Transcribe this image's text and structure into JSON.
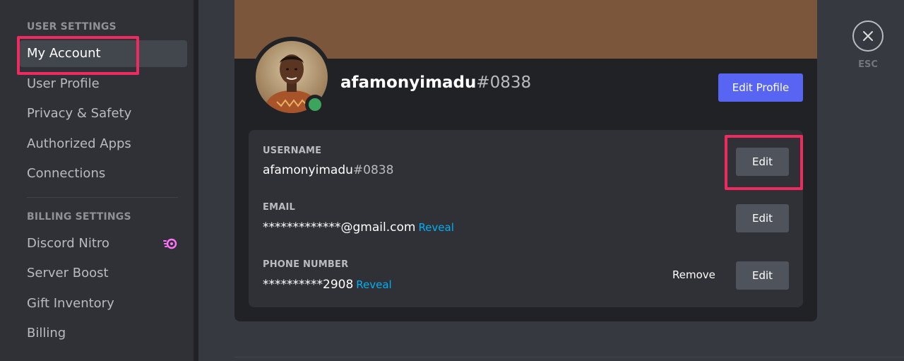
{
  "sidebar": {
    "user_settings_header": "USER SETTINGS",
    "user_items": [
      {
        "label": "My Account",
        "selected": true
      },
      {
        "label": "User Profile"
      },
      {
        "label": "Privacy & Safety"
      },
      {
        "label": "Authorized Apps"
      },
      {
        "label": "Connections"
      }
    ],
    "billing_settings_header": "BILLING SETTINGS",
    "billing_items": [
      {
        "label": "Discord Nitro",
        "icon": "nitro-icon"
      },
      {
        "label": "Server Boost"
      },
      {
        "label": "Gift Inventory"
      },
      {
        "label": "Billing"
      }
    ]
  },
  "profile": {
    "username": "afamonyimadu",
    "discriminator": "#0838",
    "status": "online",
    "banner_color": "#7b563a",
    "edit_profile_label": "Edit Profile"
  },
  "account_fields": {
    "username": {
      "label": "USERNAME",
      "value": "afamonyimadu",
      "discriminator": "#0838",
      "edit_label": "Edit"
    },
    "email": {
      "label": "EMAIL",
      "value": "*************@gmail.com",
      "reveal_label": "Reveal",
      "edit_label": "Edit"
    },
    "phone": {
      "label": "PHONE NUMBER",
      "value": "**********2908",
      "reveal_label": "Reveal",
      "remove_label": "Remove",
      "edit_label": "Edit"
    }
  },
  "close": {
    "icon": "close-icon",
    "esc_label": "ESC"
  },
  "colors": {
    "accent": "#5865f2",
    "highlight": "#ee2a5f",
    "link": "#00aff4",
    "online": "#3ba55d"
  }
}
